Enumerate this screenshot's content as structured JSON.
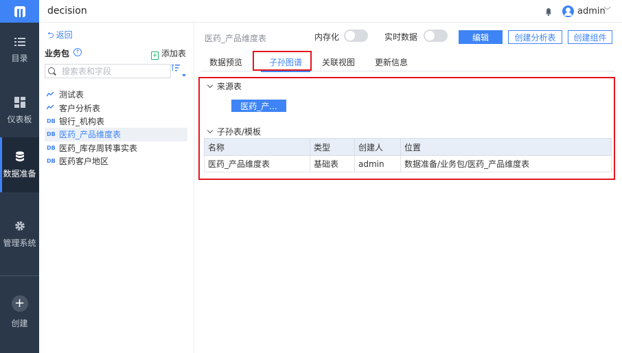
{
  "app": {
    "title": "decision",
    "user": "admin"
  },
  "nav": {
    "items": [
      {
        "label": "目录",
        "icon": "list-icon"
      },
      {
        "label": "仪表板",
        "icon": "dashboard-icon"
      },
      {
        "label": "数据准备",
        "icon": "database-icon",
        "active": true
      },
      {
        "label": "管理系统",
        "icon": "gear-icon"
      }
    ],
    "create_label": "创建"
  },
  "package": {
    "back_label": "返回",
    "title": "业务包",
    "add_table_label": "添加表",
    "search_placeholder": "搜索表和字段",
    "tables": [
      {
        "icon": "analysis",
        "name": "测试表"
      },
      {
        "icon": "analysis",
        "name": "客户分析表"
      },
      {
        "icon": "DB",
        "name": "银行_机构表"
      },
      {
        "icon": "DB",
        "name": "医药_产品维度表",
        "selected": true
      },
      {
        "icon": "DB",
        "name": "医药_库存周转事实表"
      },
      {
        "icon": "DB",
        "name": "医药客户地区"
      }
    ]
  },
  "main": {
    "table_title": "医药_产品维度表",
    "memory_label": "内存化",
    "realtime_label": "实时数据",
    "buttons": {
      "edit": "编辑",
      "create_analysis": "创建分析表",
      "create_component": "创建组件"
    },
    "tabs": [
      "数据预览",
      "子孙图谱",
      "关联视图",
      "更新信息"
    ],
    "active_tab": "子孙图谱",
    "source_section": "来源表",
    "source_chip": "医药_产...",
    "child_section": "子孙表/模板",
    "columns": [
      "名称",
      "类型",
      "创建人",
      "位置"
    ],
    "rows": [
      [
        "医药_产品维度表",
        "基础表",
        "admin",
        "数据准备/业务包/医药_产品维度表"
      ]
    ]
  },
  "colors": {
    "accent": "#3e84f6",
    "nav_bg": "#2b3849",
    "highlight": "#e4141c"
  }
}
